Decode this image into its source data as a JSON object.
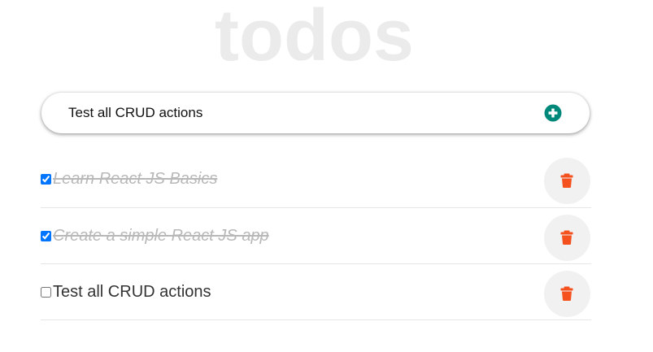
{
  "app": {
    "title": "todos"
  },
  "new_todo": {
    "value": "Test all CRUD actions",
    "add_icon": "plus-circle-icon",
    "add_icon_color": "#00897b"
  },
  "todos": [
    {
      "text": "Learn React JS Basics",
      "completed": true,
      "delete_icon": "trash-icon"
    },
    {
      "text": "Create a simple React JS app",
      "completed": true,
      "delete_icon": "trash-icon"
    },
    {
      "text": "Test all CRUD actions",
      "completed": false,
      "delete_icon": "trash-icon"
    }
  ],
  "colors": {
    "title": "#ebebeb",
    "delete_icon": "#f4511e",
    "delete_button_bg": "#f1f1f1",
    "completed_text": "#b8b8b8"
  }
}
